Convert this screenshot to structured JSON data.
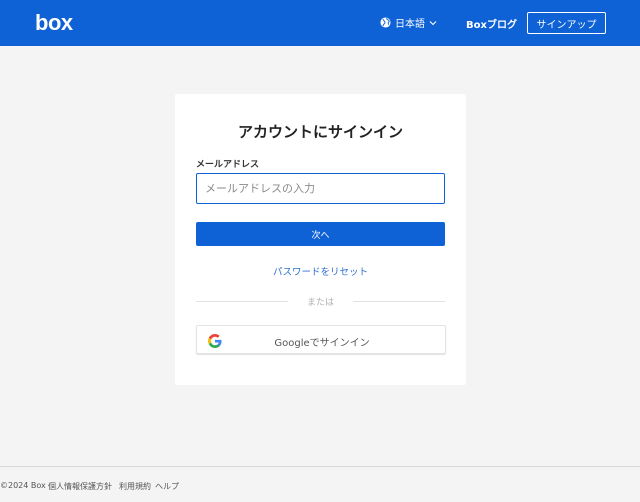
{
  "header": {
    "logo_text": "box",
    "language": "日本語",
    "blog_label": "Boxブログ",
    "signup_label": "サインアップ",
    "brand_color": "#0f62d6"
  },
  "login": {
    "title": "アカウントにサインイン",
    "email_label": "メールアドレス",
    "email_placeholder": "メールアドレスの入力",
    "email_value": "",
    "next_label": "次へ",
    "reset_label": "パスワードをリセット",
    "divider_text": "または",
    "google_label": "Googleでサインイン"
  },
  "footer": {
    "copyright": "©2024 Box",
    "privacy": "個人情報保護方針",
    "terms": "利用規約",
    "help": "ヘルプ"
  },
  "icons": {
    "language": "globe-icon",
    "language_dropdown": "chevron-down-icon",
    "google": "google-g-icon"
  }
}
